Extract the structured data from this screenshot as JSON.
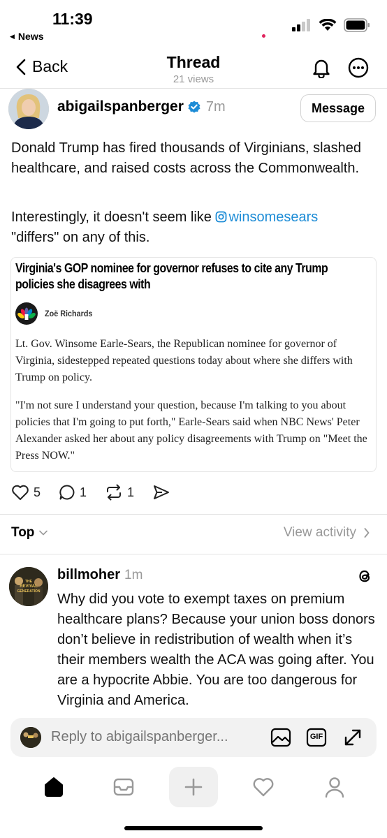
{
  "status_bar": {
    "time": "11:39",
    "back_app": "News"
  },
  "nav": {
    "back_label": "Back",
    "title": "Thread",
    "views": "21 views"
  },
  "post": {
    "author": "abigailspanberger",
    "verified": true,
    "time": "7m",
    "message_button": "Message",
    "paragraph1": "Donald Trump has fired thousands of Virginians, slashed healthcare, and raised costs across the Commonwealth.",
    "paragraph2_before": "Interestingly, it doesn't seem like ",
    "mention": "winsomesears",
    "paragraph2_after": "\"differs\" on any of this.",
    "article": {
      "headline": "Virginia's GOP nominee for governor refuses to cite any Trump policies she disagrees with",
      "byline": "Zoë Richards",
      "body1": "Lt. Gov. Winsome Earle-Sears, the Republican nominee for governor of Virginia, sidestepped repeated questions today about where she differs with Trump on policy.",
      "body2": "\"I'm not sure I understand your question, because I'm talking to you about policies that I'm going to put forth,\" Earle-Sears said when NBC News' Peter Alexander asked her about any policy disagreements with Trump on \"Meet the Press NOW.\""
    },
    "likes": "5",
    "replies": "1",
    "reposts": "1"
  },
  "sort": {
    "label": "Top",
    "view_activity": "View activity"
  },
  "reply": {
    "author": "billmoher",
    "time": "1m",
    "avatar_text_line1": "THE",
    "avatar_text_line2": "REVIVAL",
    "avatar_text_line3": "GENERATION",
    "text": "Why did you vote to exempt taxes on premium healthcare plans?  Because your union boss donors don’t believe in redistribution of wealth when it’s their members wealth the ACA was going after.  You are a hypocrite Abbie.  You are too dangerous for Virginia and America."
  },
  "reply_bar": {
    "placeholder": "Reply to abigailspanberger...",
    "gif_label": "GIF"
  },
  "colors": {
    "accent": "#1d8cd6",
    "muted": "#999999",
    "notification": "#e0245e"
  }
}
